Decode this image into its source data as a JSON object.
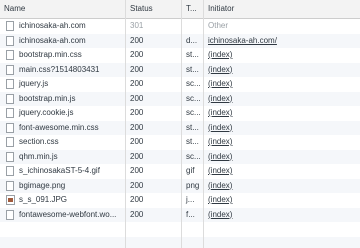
{
  "columns": {
    "name": "Name",
    "status": "Status",
    "type": "T...",
    "initiator": "Initiator"
  },
  "rows": [
    {
      "name": "ichinosaka-ah.com",
      "status": "301",
      "type": "",
      "initiator": "Other",
      "icon": "document-icon",
      "muted": true
    },
    {
      "name": "ichinosaka-ah.com",
      "status": "200",
      "type": "d...",
      "initiator": "ichinosaka-ah.com/",
      "icon": "document-icon",
      "muted": false
    },
    {
      "name": "bootstrap.min.css",
      "status": "200",
      "type": "st...",
      "initiator": "(index)",
      "icon": "document-icon",
      "muted": false
    },
    {
      "name": "main.css?1514803431",
      "status": "200",
      "type": "st...",
      "initiator": "(index)",
      "icon": "document-icon",
      "muted": false
    },
    {
      "name": "jquery.js",
      "status": "200",
      "type": "sc...",
      "initiator": "(index)",
      "icon": "document-icon",
      "muted": false
    },
    {
      "name": "bootstrap.min.js",
      "status": "200",
      "type": "sc...",
      "initiator": "(index)",
      "icon": "document-icon",
      "muted": false
    },
    {
      "name": "jquery.cookie.js",
      "status": "200",
      "type": "sc...",
      "initiator": "(index)",
      "icon": "document-icon",
      "muted": false
    },
    {
      "name": "font-awesome.min.css",
      "status": "200",
      "type": "st...",
      "initiator": "(index)",
      "icon": "document-icon",
      "muted": false
    },
    {
      "name": "section.css",
      "status": "200",
      "type": "st...",
      "initiator": "(index)",
      "icon": "document-icon",
      "muted": false
    },
    {
      "name": "qhm.min.js",
      "status": "200",
      "type": "sc...",
      "initiator": "(index)",
      "icon": "document-icon",
      "muted": false
    },
    {
      "name": "s_ichinosakaST-5-4.gif",
      "status": "200",
      "type": "gif",
      "initiator": "(index)",
      "icon": "document-icon",
      "muted": false
    },
    {
      "name": "bgimage.png",
      "status": "200",
      "type": "png",
      "initiator": "(index)",
      "icon": "document-icon",
      "muted": false
    },
    {
      "name": "s_s_091.JPG",
      "status": "200",
      "type": "j...",
      "initiator": "(index)",
      "icon": "image-icon",
      "muted": false
    },
    {
      "name": "fontawesome-webfont.wo...",
      "status": "200",
      "type": "f...",
      "initiator": "(index)",
      "icon": "document-icon",
      "muted": false
    }
  ],
  "colors": {
    "header_bg": "#f3f3f3",
    "row_alt_bg": "#f5f7fa",
    "muted_text": "#9aa0a6",
    "text": "#303942"
  }
}
